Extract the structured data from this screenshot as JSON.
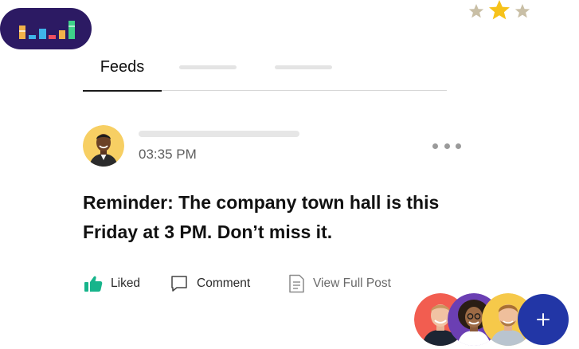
{
  "brand": {
    "logo_icon": "bar-chart-logo",
    "bar_colors": [
      "#f2b24a",
      "#3fb3e8",
      "#f14f5f",
      "#3fb3e8",
      "#f2b24a",
      "#3ed08a"
    ],
    "pill_color": "#2c1a63"
  },
  "rating": {
    "stars": [
      {
        "icon": "star-icon",
        "state": "inactive",
        "color": "#c9bfa6"
      },
      {
        "icon": "star-icon",
        "state": "active",
        "color": "#f6c21b"
      },
      {
        "icon": "star-icon",
        "state": "inactive",
        "color": "#c9bfa6"
      }
    ]
  },
  "tabs": [
    {
      "label": "Feeds",
      "active": true
    }
  ],
  "post": {
    "time": "03:35 PM",
    "line1": "Reminder: The company town hall is this",
    "line2": "Friday at 3 PM. Don’t miss it.",
    "more_icon": "more-dots-icon"
  },
  "actions": {
    "like": {
      "label": "Liked",
      "icon": "thumbs-up-icon",
      "color": "#17b48b"
    },
    "comment": {
      "label": "Comment",
      "icon": "comment-icon"
    },
    "view": {
      "label": "View Full Post",
      "icon": "document-icon"
    }
  },
  "participants": {
    "avatars": [
      {
        "name": "participant-avatar",
        "bg": "#f25d50"
      },
      {
        "name": "participant-avatar",
        "bg": "#6b3fb3"
      },
      {
        "name": "participant-avatar",
        "bg": "#f6c94a"
      }
    ],
    "add_icon": "plus-icon",
    "add_color": "#2236a6"
  }
}
